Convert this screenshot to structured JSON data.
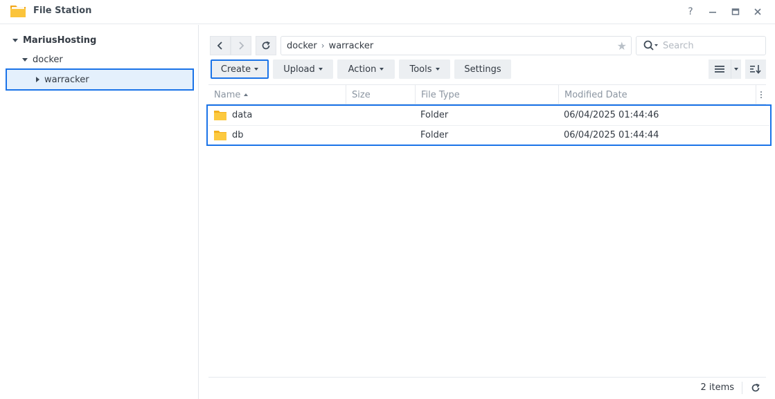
{
  "window": {
    "title": "File Station",
    "help_label": "?",
    "icon": "folder-app-icon"
  },
  "sidebar": {
    "root": "MariusHosting",
    "children": [
      {
        "label": "docker"
      },
      {
        "label": "warracker",
        "selected": true
      }
    ]
  },
  "navigation": {
    "path": [
      "docker",
      "warracker"
    ],
    "search_placeholder": "Search"
  },
  "toolbar": {
    "create": "Create",
    "upload": "Upload",
    "action": "Action",
    "tools": "Tools",
    "settings": "Settings"
  },
  "table": {
    "columns": [
      "Name",
      "Size",
      "File Type",
      "Modified Date"
    ],
    "sort_column": "Name",
    "rows": [
      {
        "name": "data",
        "size": "",
        "type": "Folder",
        "modified": "06/04/2025 01:44:46"
      },
      {
        "name": "db",
        "size": "",
        "type": "Folder",
        "modified": "06/04/2025 01:44:44"
      }
    ]
  },
  "footer": {
    "item_count": "2 items"
  },
  "colors": {
    "accent_outline": "#1a73e8",
    "folder_yellow": "#f7c43c",
    "selection_bg": "#e4f0fc"
  }
}
